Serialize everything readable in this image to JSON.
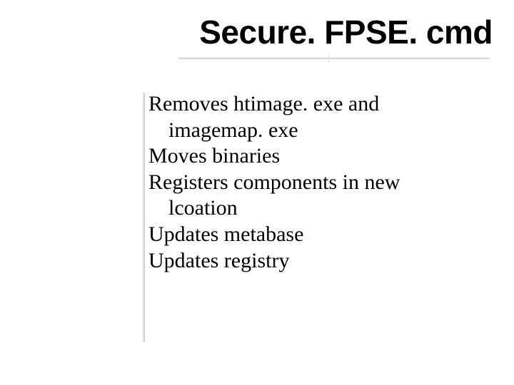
{
  "title": "Secure. FPSE. cmd",
  "body": {
    "items": [
      {
        "lines": [
          "Removes htimage. exe and",
          "imagemap. exe"
        ]
      },
      {
        "lines": [
          "Moves binaries"
        ]
      },
      {
        "lines": [
          "Registers components in new",
          "lcoation"
        ]
      },
      {
        "lines": [
          "Updates metabase"
        ]
      },
      {
        "lines": [
          "Updates registry"
        ]
      }
    ]
  }
}
